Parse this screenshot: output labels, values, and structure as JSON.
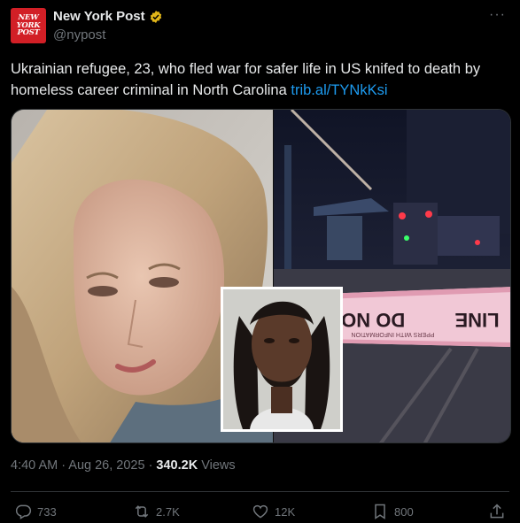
{
  "tweet": {
    "avatar_text": [
      "NEW",
      "YORK",
      "POST"
    ],
    "display_name": "New York Post",
    "handle": "@nypost",
    "more": "···",
    "text": "Ukrainian refugee, 23, who fled war for safer life in US knifed to death by homeless career criminal in North Carolina",
    "link": "trib.al/TYNkKsi",
    "time": "4:40 AM · Aug 26, 2025 ·",
    "views_count": "340.2K",
    "views_label": "Views",
    "police_tape": "DO NOT C",
    "police_tape_tail": "LINE",
    "police_tape_small": "PPERS WITH INFORMATION"
  },
  "actions": {
    "replies": "733",
    "reposts": "2.7K",
    "likes": "12K",
    "bookmarks": "800"
  },
  "colors": {
    "background": "#000000",
    "text": "#e7e9ea",
    "muted": "#71767b",
    "link": "#1d9bf0",
    "brand": "#d21f26",
    "verified": "#e2b719"
  }
}
